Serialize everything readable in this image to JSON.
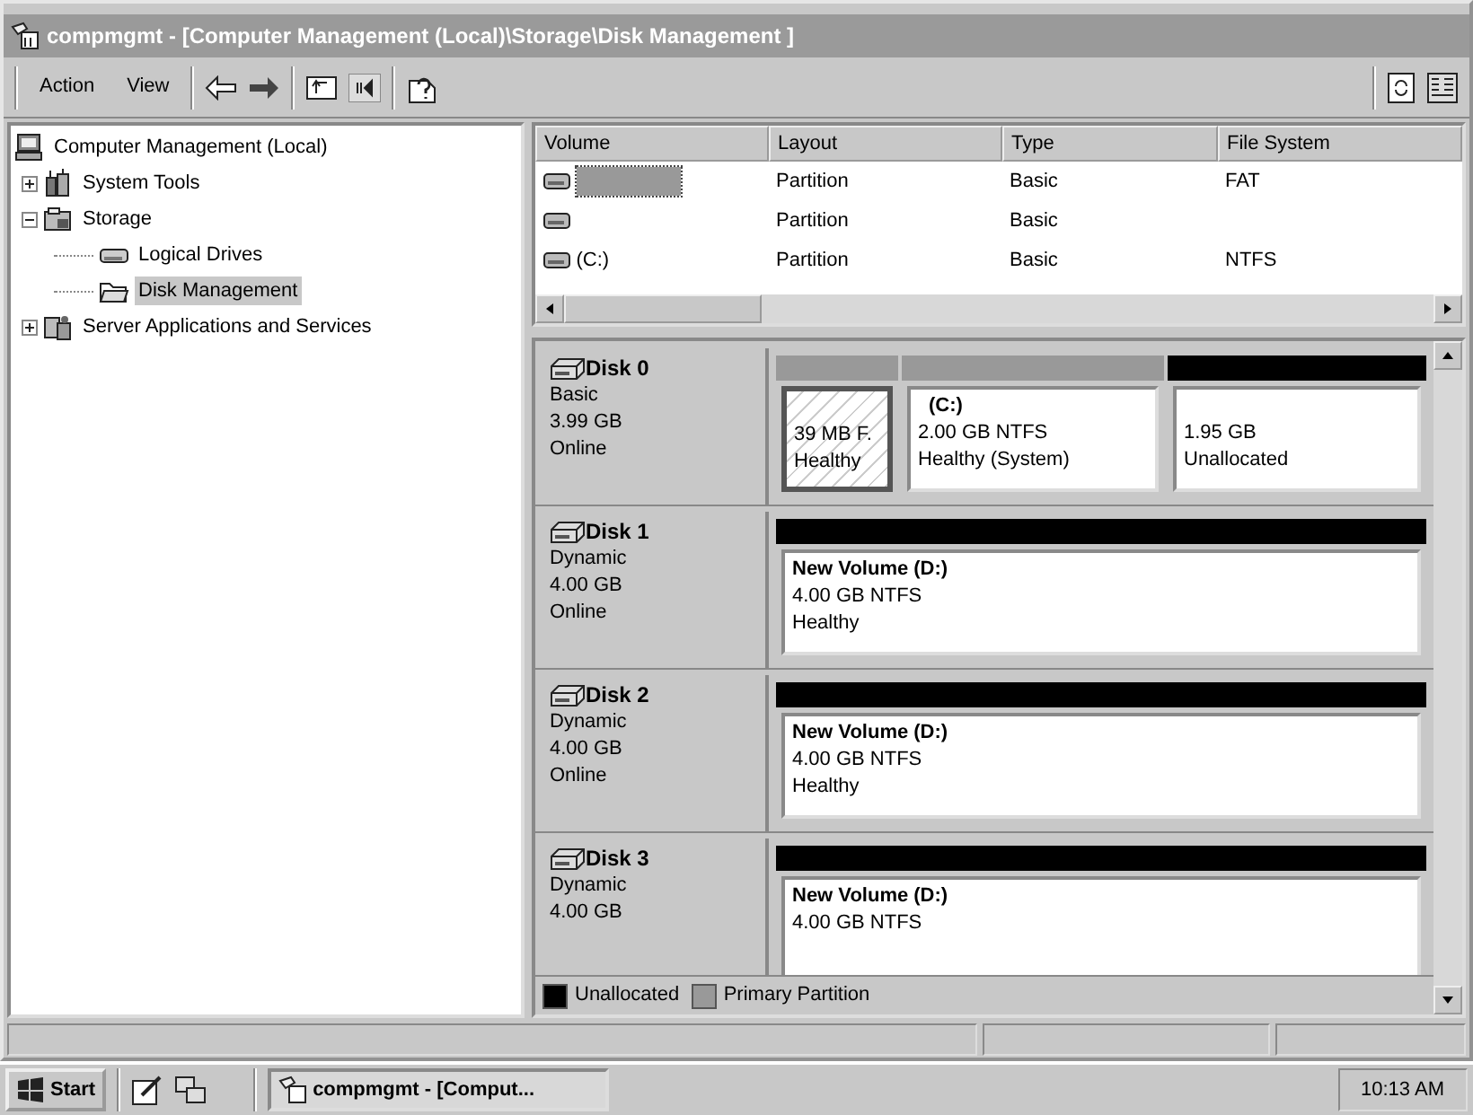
{
  "window": {
    "title": "compmgmt - [Computer Management (Local)\\Storage\\Disk Management ]"
  },
  "menu": [
    "Action",
    "View"
  ],
  "tree": [
    {
      "label": "Computer Management (Local)",
      "kind": "computer",
      "selected": false,
      "children": [
        {
          "label": "System Tools",
          "kind": "tools",
          "expanded": false,
          "selected": false
        },
        {
          "label": "Storage",
          "kind": "storage",
          "expanded": true,
          "selected": false,
          "children": [
            {
              "label": "Logical Drives",
              "kind": "drive",
              "selected": false
            },
            {
              "label": "Disk Management",
              "kind": "folder",
              "selected": true
            }
          ]
        },
        {
          "label": "Server Applications and Services",
          "kind": "services",
          "expanded": false,
          "selected": false
        }
      ]
    }
  ],
  "volume_list": {
    "columns": [
      "Volume",
      "Layout",
      "Type",
      "File System"
    ],
    "rows": [
      {
        "selected": true,
        "layout": "Partition",
        "type": "Basic",
        "file_system": "FAT"
      },
      {
        "selected": false,
        "layout": "Partition",
        "type": "Basic"
      },
      {
        "selected": false,
        "volume": "(C:)",
        "layout": "Partition",
        "type": "Basic",
        "file_system": "NTFS"
      }
    ]
  },
  "disks": [
    {
      "name": "Disk 0",
      "type": "Basic",
      "size": "3.99 GB",
      "status": "Online",
      "partitions": [
        {
          "kind": "primary",
          "selected": true,
          "size": "39 MB F.",
          "status": "Healthy"
        },
        {
          "kind": "primary",
          "selected": false,
          "label": "(C:)",
          "size": "2.00 GB NTFS",
          "status": "Healthy (System)"
        },
        {
          "kind": "unallocated",
          "selected": false,
          "size": "1.95 GB",
          "status": "Unallocated"
        }
      ]
    },
    {
      "name": "Disk 1",
      "type": "Dynamic",
      "size": "4.00 GB",
      "status": "Online",
      "partitions": [
        {
          "kind": "unallocated",
          "selected": false,
          "label": "New Volume  (D:)",
          "size": "4.00 GB NTFS",
          "status": "Healthy"
        }
      ]
    },
    {
      "name": "Disk 2",
      "type": "Dynamic",
      "size": "4.00 GB",
      "status": "Online",
      "partitions": [
        {
          "kind": "unallocated",
          "selected": false,
          "label": "New Volume  (D:)",
          "size": "4.00 GB NTFS",
          "status": "Healthy"
        }
      ]
    },
    {
      "name": "Disk 3",
      "type": "Dynamic",
      "size": "4.00 GB",
      "partitions": [
        {
          "kind": "unallocated",
          "selected": false,
          "label": "New Volume  (D:)",
          "size": "4.00 GB NTFS"
        }
      ]
    }
  ],
  "legend": [
    {
      "kind": "unallocated",
      "label": "Unallocated"
    },
    {
      "kind": "primary",
      "label": "Primary Partition"
    }
  ],
  "taskbar": {
    "start": "Start",
    "task": "compmgmt - [Comput...",
    "clock": "10:13 AM"
  }
}
